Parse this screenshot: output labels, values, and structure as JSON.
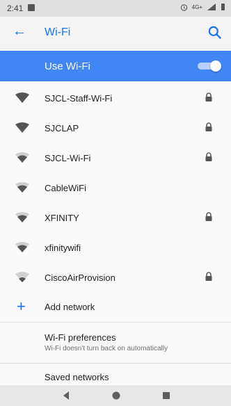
{
  "status_bar": {
    "time": "2:41",
    "signal_label": "4G+"
  },
  "app_bar": {
    "title": "Wi-Fi"
  },
  "master_switch": {
    "label": "Use Wi-Fi",
    "enabled": true
  },
  "networks": [
    {
      "name": "SJCL-Staff-Wi-Fi",
      "signal": "full",
      "secured": true
    },
    {
      "name": "SJCLAP",
      "signal": "full",
      "secured": true
    },
    {
      "name": "SJCL-Wi-Fi",
      "signal": "medium",
      "secured": true
    },
    {
      "name": "CableWiFi",
      "signal": "medium",
      "secured": false
    },
    {
      "name": "XFINITY",
      "signal": "medium",
      "secured": true
    },
    {
      "name": "xfinitywifi",
      "signal": "medium",
      "secured": false
    },
    {
      "name": "CiscoAirProvision",
      "signal": "low",
      "secured": true
    }
  ],
  "add_network": {
    "label": "Add network"
  },
  "preferences": {
    "title": "Wi-Fi preferences",
    "subtitle": "Wi-Fi doesn't turn back on automatically"
  },
  "saved_networks": {
    "title": "Saved networks"
  },
  "colors": {
    "accent": "#1a73e8",
    "master_bar": "#4285f4"
  },
  "icons": {
    "back": "arrow-left",
    "search": "magnifier",
    "wifi": "wifi-fan",
    "lock": "padlock",
    "add": "plus",
    "nav_back": "triangle-left",
    "nav_home": "circle",
    "nav_recents": "square"
  }
}
